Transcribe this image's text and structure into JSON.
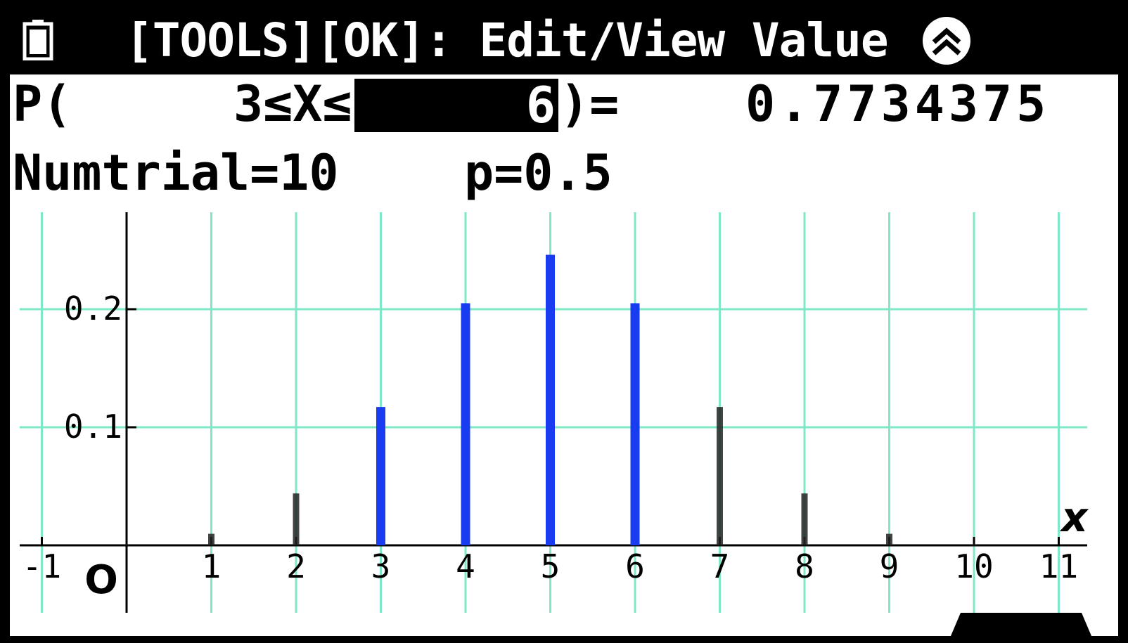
{
  "header": {
    "title": "[TOOLS][OK]: Edit/View Value",
    "battery_icon": "battery-icon",
    "scroll_icon": "double-chevron-up-icon"
  },
  "prob_line": {
    "prefix": "P(",
    "lower": "3≤X≤",
    "upper": "6",
    "close_eq": ")=",
    "result": "0.7734375"
  },
  "params": {
    "numtrial": "Numtrial=10",
    "p": "p=0.5"
  },
  "colors": {
    "grid": "#7fe8c8",
    "selected_bar": "#1a3cf0",
    "unselected_bar": "#222222"
  },
  "chart_data": {
    "type": "bar",
    "title": "",
    "xlabel": "x",
    "ylabel": "",
    "x_ticks": [
      "-1",
      "1",
      "2",
      "3",
      "4",
      "5",
      "6",
      "7",
      "8",
      "9",
      "10",
      "11"
    ],
    "y_ticks": [
      "0.1",
      "0.2"
    ],
    "origin_label": "O",
    "xlim": [
      -1.5,
      11.3
    ],
    "ylim": [
      -0.055,
      0.28
    ],
    "grid": true,
    "selected_range": [
      3,
      6
    ],
    "x": [
      0,
      1,
      2,
      3,
      4,
      5,
      6,
      7,
      8,
      9,
      10
    ],
    "values": [
      0.0009765625,
      0.009765625,
      0.0439453125,
      0.1171875,
      0.205078125,
      0.24609375,
      0.205078125,
      0.1171875,
      0.0439453125,
      0.009765625,
      0.0009765625
    ]
  }
}
